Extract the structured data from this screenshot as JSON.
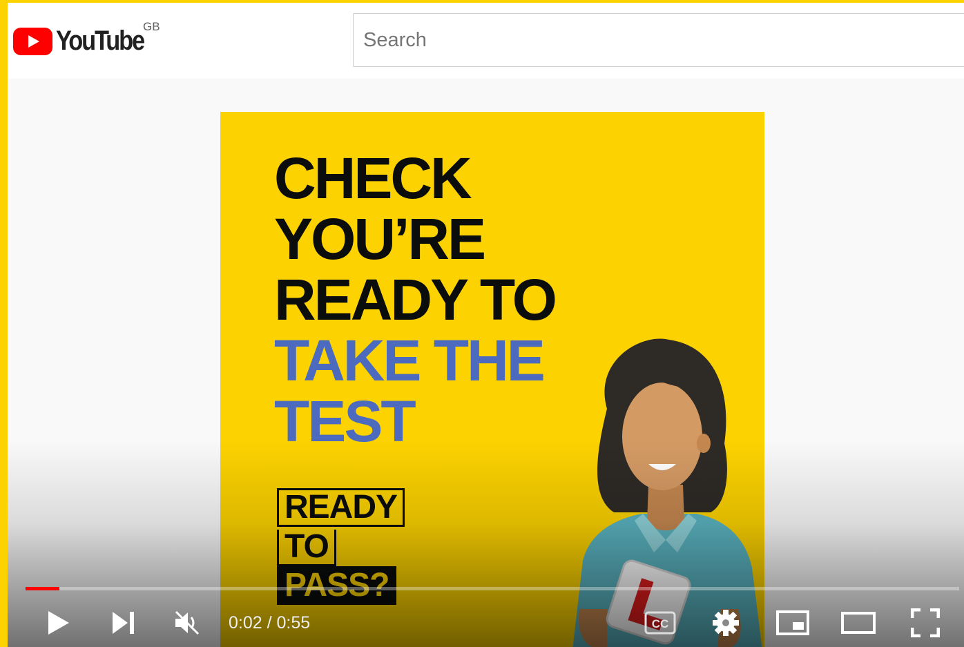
{
  "masthead": {
    "logo_text": "YouTube",
    "country_code": "GB",
    "search_placeholder": "Search"
  },
  "video": {
    "headline": {
      "line1": "CHECK",
      "line2": "YOU’RE",
      "line3": "READY TO",
      "line4": "TAKE THE",
      "line5": "TEST"
    },
    "badge": {
      "line1": "READY",
      "line2": "TO",
      "line3": "PASS?"
    },
    "l_plate_letter": "L",
    "colors": {
      "background": "#fcd200",
      "headline_dark": "#0b0c0c",
      "headline_blue": "#4c6bbf"
    }
  },
  "player": {
    "progress_fraction": 0.036,
    "time_display": "0:02 / 0:55",
    "cc_label": "CC",
    "accent_color": "#ff0000",
    "controls": [
      "play-icon",
      "next-icon",
      "mute-icon",
      "cc-icon",
      "settings-icon",
      "miniplayer-icon",
      "theater-icon",
      "fullscreen-icon"
    ]
  }
}
